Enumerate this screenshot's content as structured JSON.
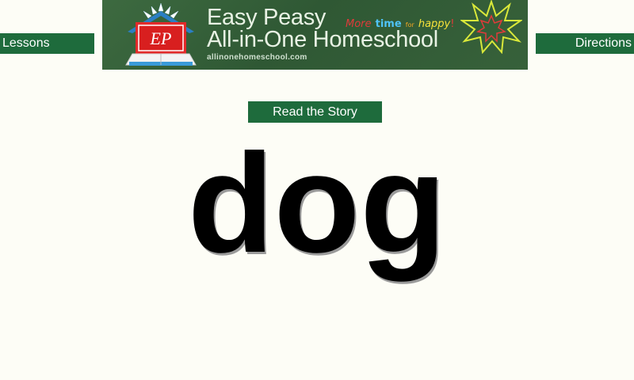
{
  "nav": {
    "lessons_label": "Lessons",
    "directions_label": "Directions"
  },
  "banner": {
    "title_line1": "Easy Peasy",
    "title_line2": "All-in-One Homeschool",
    "url": "allinonehomeschool.com",
    "logo_text": "EP",
    "tagline": {
      "more": "More",
      "time": "time",
      "for": "for",
      "happy": "happy",
      "bang": "!"
    }
  },
  "main": {
    "read_story_label": "Read the Story",
    "word": "dog"
  },
  "colors": {
    "button_green": "#1e6b3c",
    "banner_green": "#2f5834",
    "background": "#fdfdf6"
  }
}
